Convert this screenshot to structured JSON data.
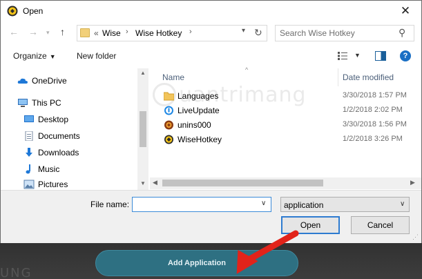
{
  "dialog": {
    "title": "Open",
    "close_label": "✕"
  },
  "navigation": {
    "back_icon": "back-arrow-icon",
    "forward_icon": "forward-arrow-icon",
    "recent_icon": "chevron-down-icon",
    "up_icon": "up-arrow-icon",
    "breadcrumb": {
      "overflow": "«",
      "items": [
        "Wise",
        "Wise Hotkey"
      ]
    },
    "search_placeholder": "Search Wise Hotkey"
  },
  "toolbar": {
    "organize_label": "Organize",
    "new_folder_label": "New folder",
    "help_label": "?"
  },
  "watermark": {
    "text": "uantrimang"
  },
  "nav_pane": {
    "items": [
      {
        "label": "OneDrive",
        "icon": "cloud-icon"
      },
      {
        "label": "This PC",
        "icon": "computer-icon"
      },
      {
        "label": "Desktop",
        "icon": "desktop-icon"
      },
      {
        "label": "Documents",
        "icon": "documents-icon"
      },
      {
        "label": "Downloads",
        "icon": "download-icon"
      },
      {
        "label": "Music",
        "icon": "music-icon"
      },
      {
        "label": "Pictures",
        "icon": "pictures-icon"
      }
    ]
  },
  "file_list": {
    "columns": [
      "Name",
      "Date modified"
    ],
    "rows": [
      {
        "name": "Languages",
        "date": "3/30/2018 1:57 PM",
        "icon": "folder-icon"
      },
      {
        "name": "LiveUpdate",
        "date": "1/2/2018 2:02 PM",
        "icon": "update-icon"
      },
      {
        "name": "unins000",
        "date": "3/30/2018 1:56 PM",
        "icon": "uninstaller-icon"
      },
      {
        "name": "WiseHotkey",
        "date": "1/2/2018 3:26 PM",
        "icon": "wisehotkey-icon"
      }
    ]
  },
  "footer": {
    "file_name_label": "File name:",
    "file_name_value": "",
    "file_type_value": "application",
    "open_label": "Open",
    "cancel_label": "Cancel"
  },
  "background_app": {
    "add_button_label": "Add Application",
    "ghost_text": "UNG"
  },
  "colors": {
    "accent_blue": "#2d7bd0",
    "add_button_bg": "#2e7082",
    "arrow_red": "#e2231a"
  }
}
